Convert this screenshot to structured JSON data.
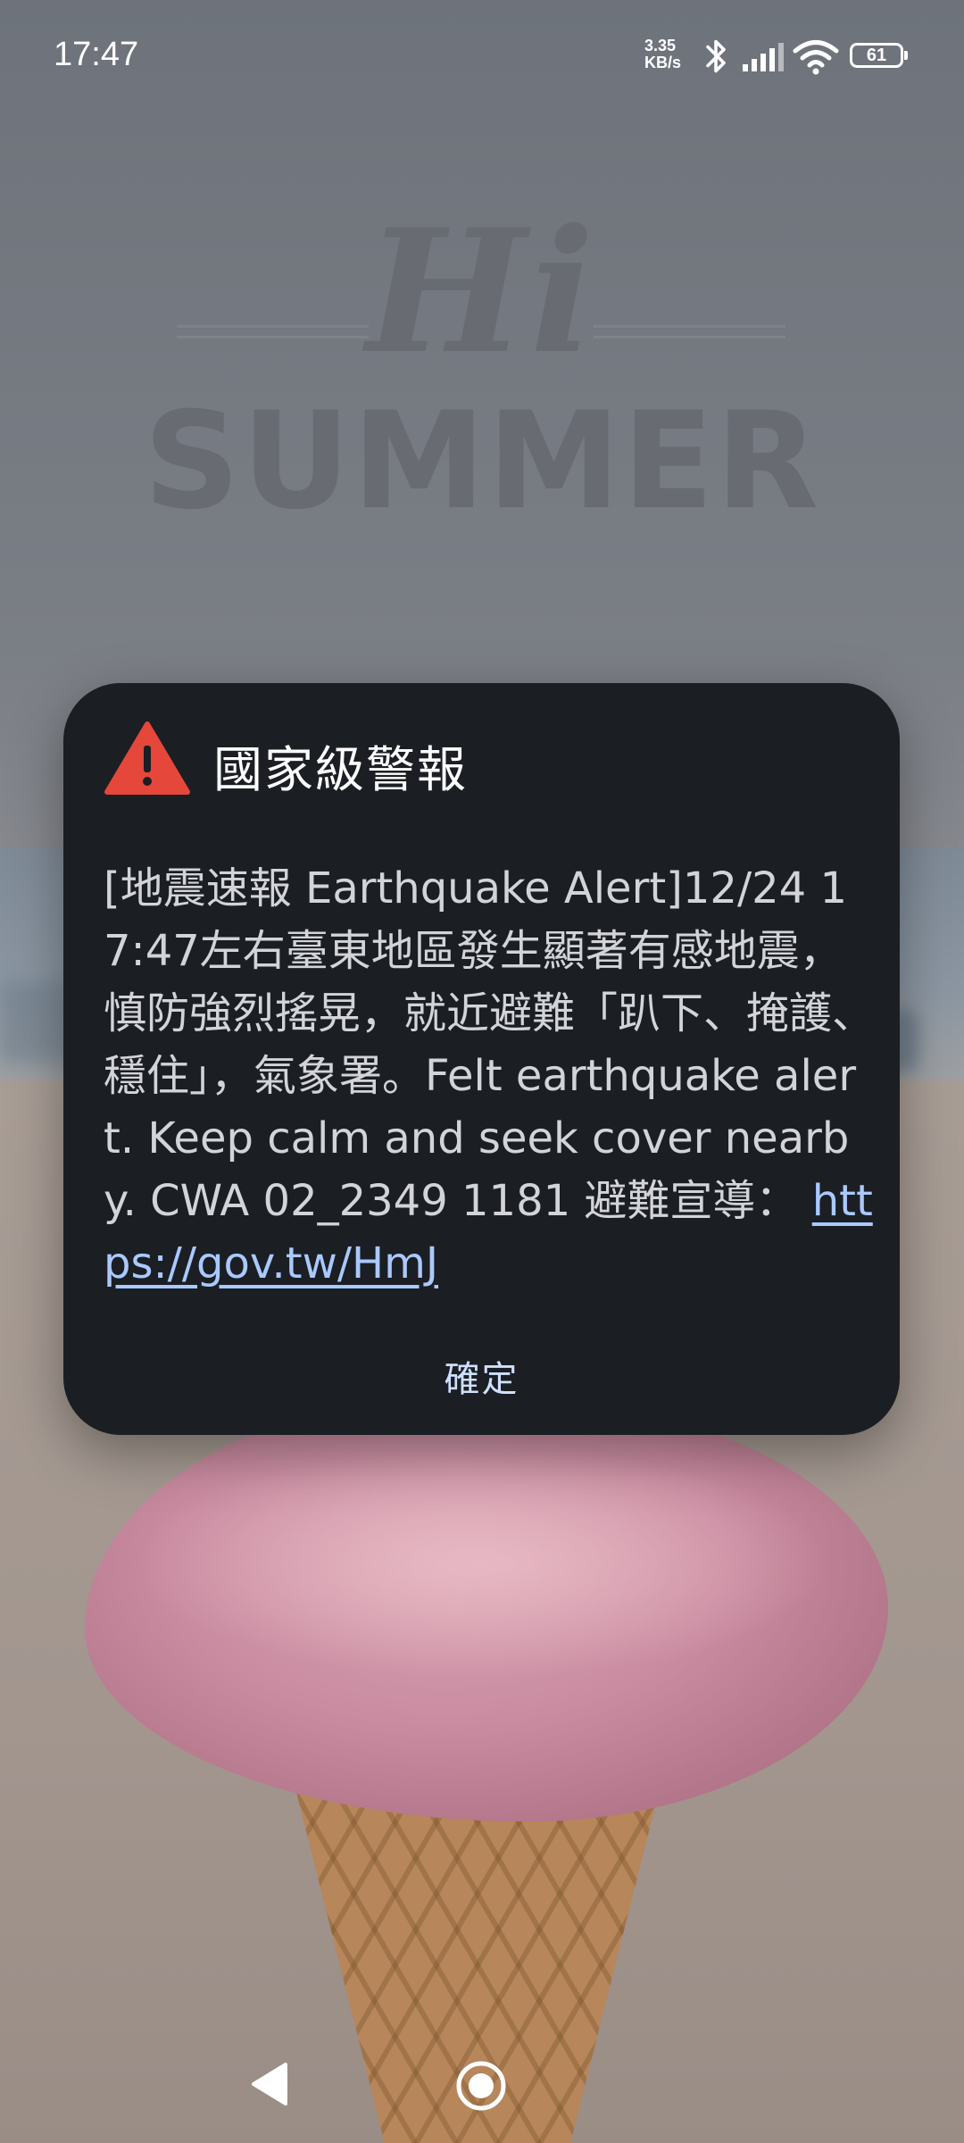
{
  "status_bar": {
    "time": "17:47",
    "net_speed_value": "3.35",
    "net_speed_unit": "KB/s",
    "battery_level": "61"
  },
  "alert_dialog": {
    "title": "國家級警報",
    "message": "[地震速報 Earthquake Alert]12/24 17:47左右臺東地區發生顯著有感地震，慎防強烈搖晃，就近避難「趴下、掩護、穩住」，氣象署。Felt earthquake alert. Keep calm and seek cover nearby. CWA 02_2349 1181 避難宣導：",
    "link_text": "https://gov.tw/HmJ",
    "confirm_label": "確定",
    "icon": "warning-triangle-icon",
    "accent_color": "#e5473a"
  },
  "wallpaper": {
    "text_hi": "Hi",
    "text_summer": "SUMMER"
  },
  "navigation_bar": {
    "back_icon": "back-triangle-icon",
    "home_icon": "home-circle-icon"
  }
}
